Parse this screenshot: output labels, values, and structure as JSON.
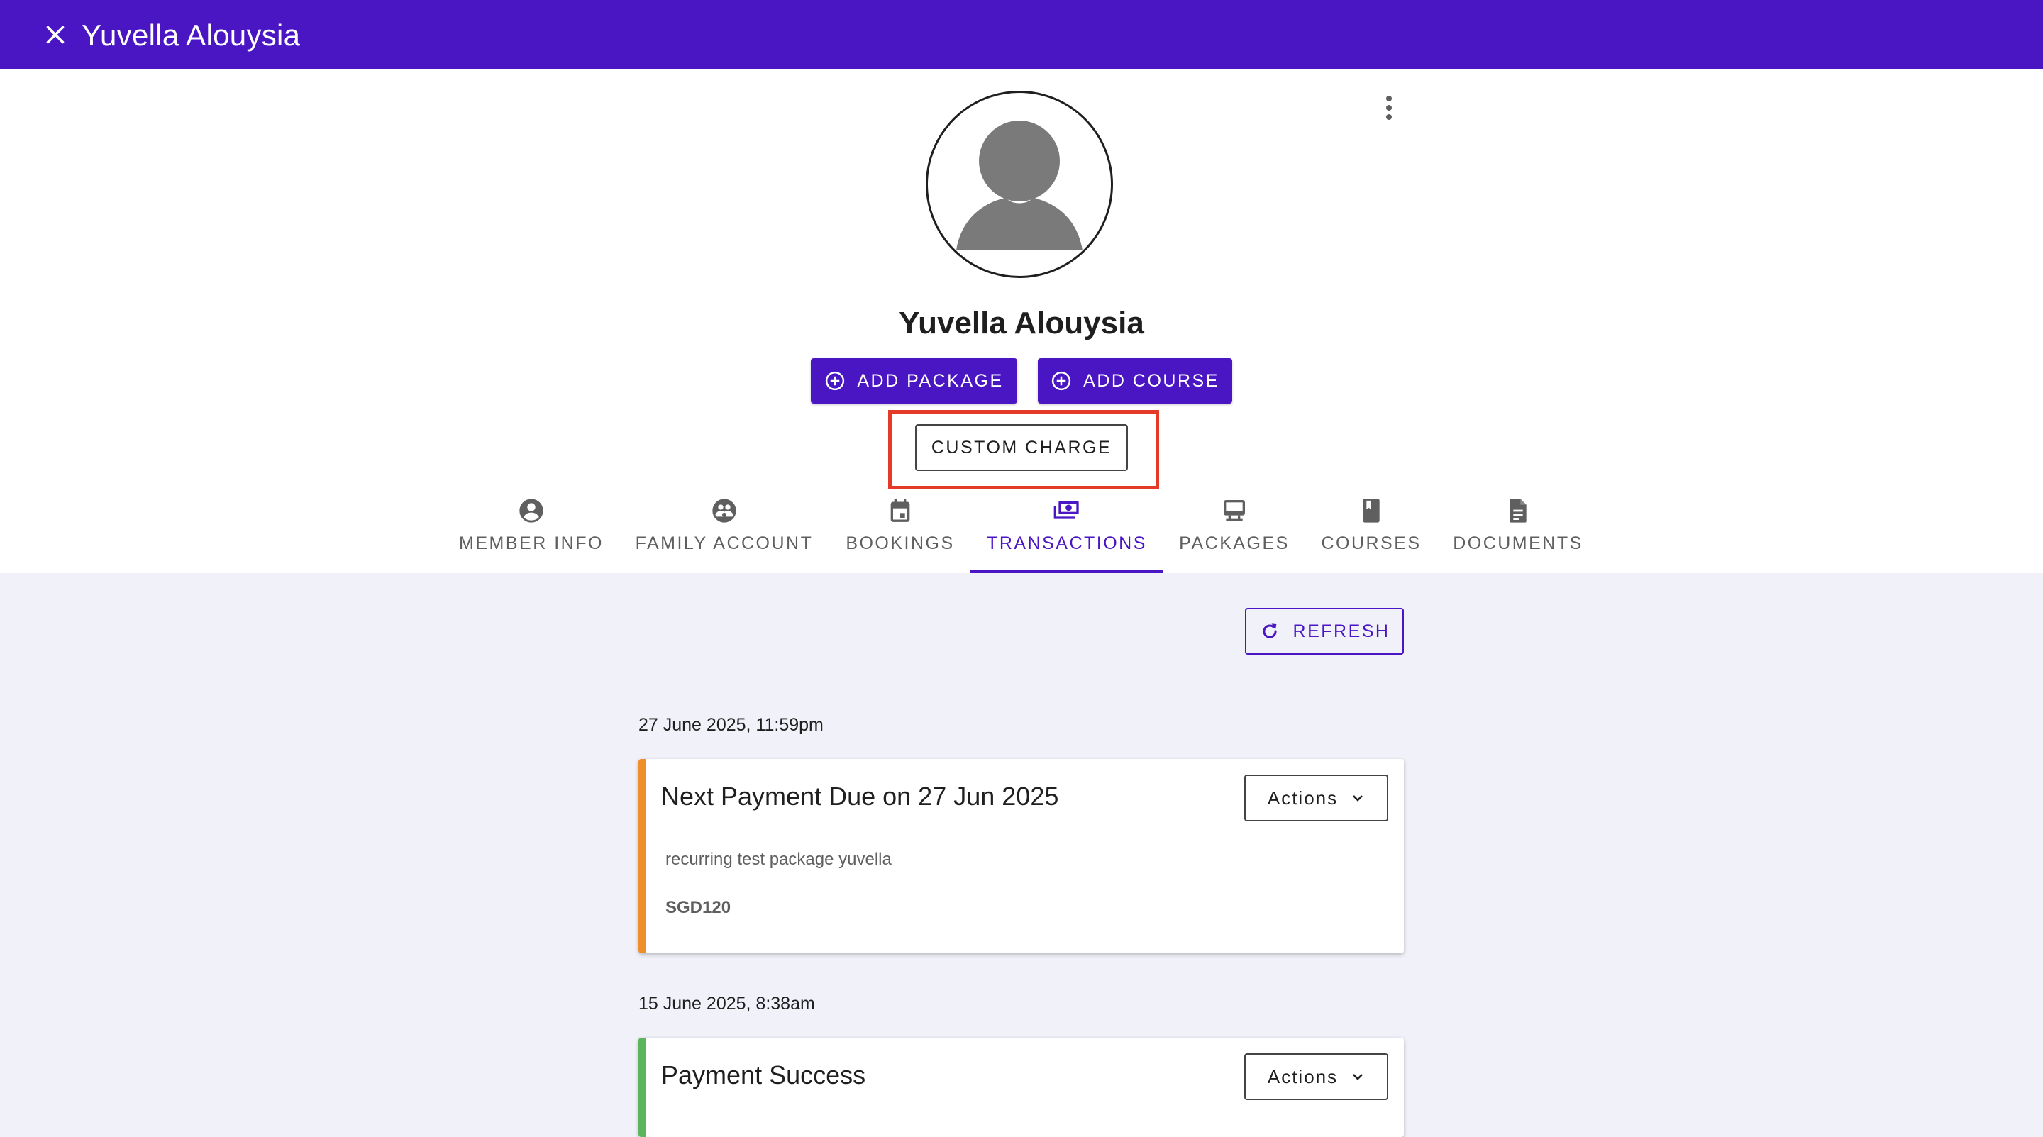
{
  "window": {
    "title": "Yuvella Alouysia"
  },
  "profile": {
    "name": "Yuvella Alouysia"
  },
  "buttons": {
    "add_package": "ADD PACKAGE",
    "add_course": "ADD COURSE",
    "custom_charge": "CUSTOM CHARGE",
    "refresh": "REFRESH"
  },
  "tabs": [
    {
      "label": "MEMBER INFO",
      "icon": "account-circle-icon"
    },
    {
      "label": "FAMILY ACCOUNT",
      "icon": "family-icon"
    },
    {
      "label": "BOOKINGS",
      "icon": "calendar-icon"
    },
    {
      "label": "TRANSACTIONS",
      "icon": "payments-icon",
      "active": true
    },
    {
      "label": "PACKAGES",
      "icon": "package-icon"
    },
    {
      "label": "COURSES",
      "icon": "book-icon"
    },
    {
      "label": "DOCUMENTS",
      "icon": "document-icon"
    }
  ],
  "transactions": [
    {
      "date": "27 June 2025, 11:59pm",
      "title": "Next Payment Due on 27 Jun 2025",
      "description": "recurring test package yuvella",
      "amount": "SGD120",
      "actions_label": "Actions",
      "status_color": "#ef8f2c"
    },
    {
      "date": "15 June 2025, 8:38am",
      "title": "Payment Success",
      "actions_label": "Actions",
      "status_color": "#5cb55c"
    }
  ],
  "colors": {
    "primary": "#4a16c4",
    "highlight": "#e33b27",
    "background": "#f1f2f9"
  }
}
